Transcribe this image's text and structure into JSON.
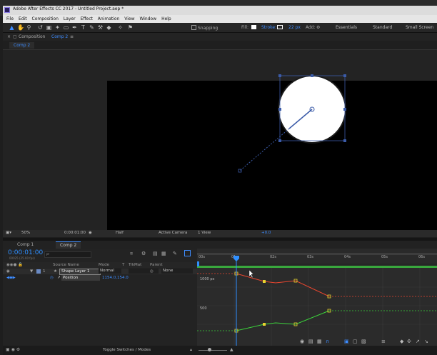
{
  "window": {
    "title": "Adobe After Effects CC 2017 - Untitled Project.aep *"
  },
  "menu": [
    "File",
    "Edit",
    "Composition",
    "Layer",
    "Effect",
    "Animation",
    "View",
    "Window",
    "Help"
  ],
  "toolbar": {
    "snapping_label": "Snapping",
    "fill_label": "Fill:",
    "stroke_label": "Stroke:",
    "stroke_width": "22 px",
    "add_label": "Add:",
    "workspaces": [
      "Essentials",
      "Standard",
      "Small Screen"
    ]
  },
  "comp_panel": {
    "label": "Composition",
    "comp_name": "Comp 2",
    "tab": "Comp 2"
  },
  "viewer_controls": {
    "zoom": "50%",
    "timecode": "0:00:01:00",
    "resolution": "Half",
    "camera": "Active Camera",
    "views": "1 View",
    "exposure": "+0.0"
  },
  "timeline": {
    "tabs": [
      "Comp 1",
      "Comp 2"
    ],
    "current_time": "0:00:01:00",
    "frame_info": "00025 (25.00 fps)",
    "search_placeholder": "ρ·",
    "columns": {
      "source": "Source Name",
      "mode": "Mode",
      "t": "T",
      "trkmat": "TrkMat",
      "parent": "Parent"
    },
    "layer": {
      "index": "1",
      "name": "Shape Layer 1",
      "mode": "Normal",
      "parent": "None"
    },
    "property": {
      "name": "Position",
      "value": "1154.0,154.0"
    },
    "ruler": [
      "00s",
      "01s",
      "02s",
      "03s",
      "04s",
      "05s",
      "06s"
    ],
    "graph_labels": [
      "1000 px",
      "500"
    ],
    "status": "Toggle Switches / Modes"
  },
  "colors": {
    "accent": "#2f8fff",
    "x_curve": "#e8462f",
    "y_curve": "#3bd13b",
    "keyframe": "#e8d32f"
  }
}
